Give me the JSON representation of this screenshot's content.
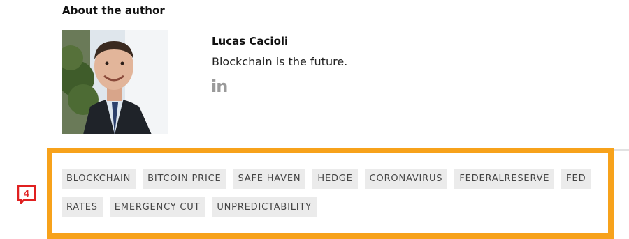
{
  "author_section": {
    "heading": "About the author",
    "name": "Lucas Cacioli",
    "bio": "Blockchain is the future.",
    "social": {
      "linkedin_text": "in",
      "icon": "linkedin-icon"
    }
  },
  "tags": [
    "BLOCKCHAIN",
    "BITCOIN PRICE",
    "SAFE HAVEN",
    "HEDGE",
    "CORONAVIRUS",
    "FEDERALRESERVE",
    "FED",
    "RATES",
    "EMERGENCY CUT",
    "UNPREDICTABILITY"
  ],
  "annotation": {
    "label": "4",
    "color": "#e02020"
  },
  "colors": {
    "highlight_border": "#f7a21b",
    "tag_bg": "#ebebeb",
    "tag_text": "#444444"
  }
}
